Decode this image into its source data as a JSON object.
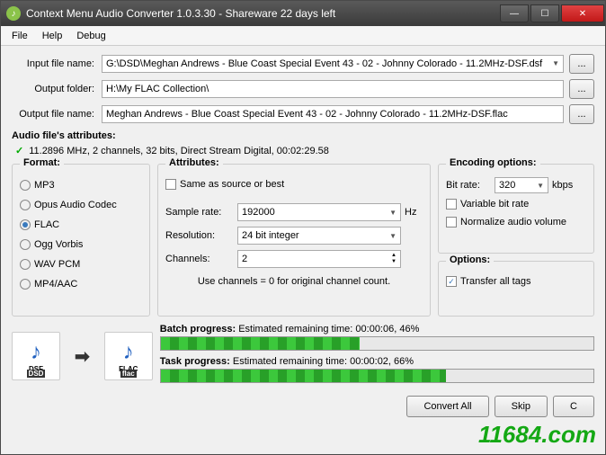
{
  "title": "Context Menu Audio Converter 1.0.3.30 - Shareware 22 days left",
  "menu": {
    "file": "File",
    "help": "Help",
    "debug": "Debug"
  },
  "files": {
    "input_label": "Input file name:",
    "input_value": "G:\\DSD\\Meghan Andrews - Blue Coast Special Event 43 - 02 - Johnny Colorado - 11.2MHz-DSF.dsf",
    "output_folder_label": "Output folder:",
    "output_folder_value": "H:\\My FLAC Collection\\",
    "output_name_label": "Output file name:",
    "output_name_value": "Meghan Andrews - Blue Coast Special Event 43 - 02 - Johnny Colorado - 11.2MHz-DSF.flac",
    "browse": "..."
  },
  "audio_attrs": {
    "title": "Audio file's attributes:",
    "text": "11.2896 MHz, 2 channels, 32 bits, Direct Stream Digital, 00:02:29.58"
  },
  "format": {
    "title": "Format:",
    "items": [
      "MP3",
      "Opus Audio Codec",
      "FLAC",
      "Ogg Vorbis",
      "WAV PCM",
      "MP4/AAC"
    ],
    "selected": "FLAC"
  },
  "attributes": {
    "title": "Attributes:",
    "same_as_source": "Same as source or best",
    "sample_rate_lbl": "Sample rate:",
    "sample_rate_val": "192000",
    "hz": "Hz",
    "resolution_lbl": "Resolution:",
    "resolution_val": "24 bit integer",
    "channels_lbl": "Channels:",
    "channels_val": "2",
    "note": "Use channels = 0 for original channel count."
  },
  "encoding": {
    "title": "Encoding options:",
    "bitrate_lbl": "Bit rate:",
    "bitrate_val": "320",
    "kbps": "kbps",
    "vbr": "Variable bit rate",
    "normalize": "Normalize audio volume"
  },
  "options": {
    "title": "Options:",
    "transfer_tags": "Transfer all tags"
  },
  "icons": {
    "src": "DSF",
    "src_sub": "DSD",
    "dst": "FLAC",
    "dst_sub": "flac"
  },
  "progress": {
    "batch_lbl": "Batch progress:",
    "batch_text": "Estimated remaining time: 00:00:06, 46%",
    "batch_pct": 46,
    "task_lbl": "Task progress:",
    "task_text": "Estimated remaining time: 00:00:02, 66%",
    "task_pct": 66
  },
  "buttons": {
    "convert": "Convert All",
    "skip": "Skip",
    "cancel": "C"
  },
  "watermark": "11684.com"
}
